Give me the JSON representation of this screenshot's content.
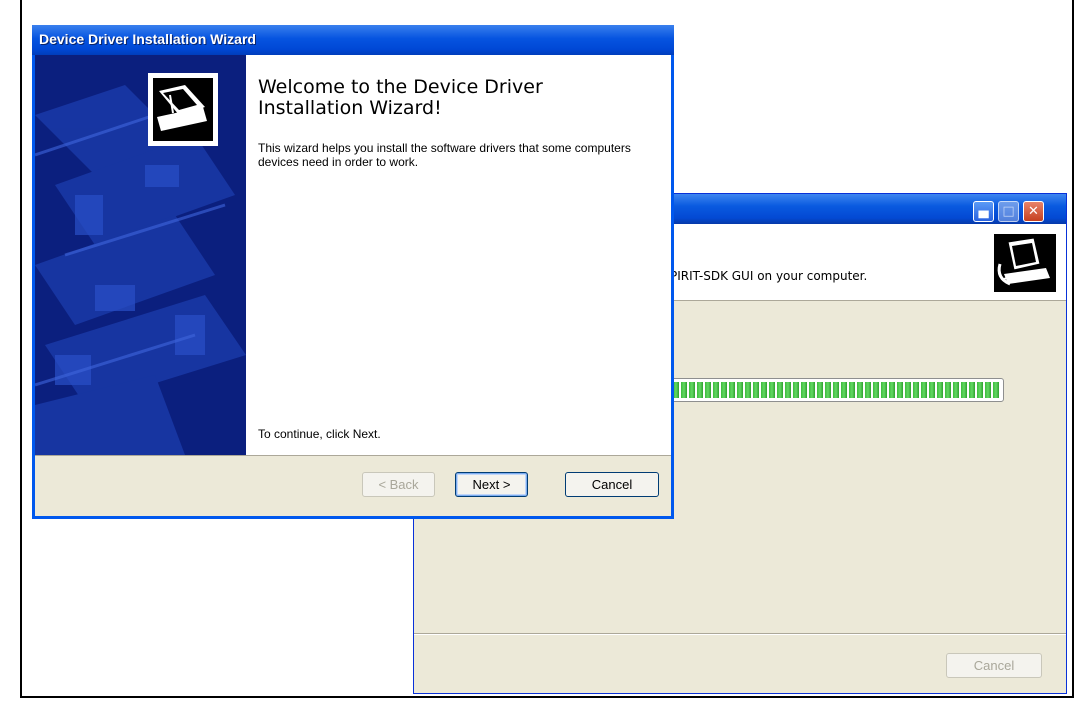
{
  "front_window": {
    "title": "Device Driver Installation Wizard",
    "welcome_heading": "Welcome to the Device Driver Installation Wizard!",
    "description": "This wizard helps you install the software drivers that some computers devices need in order to work.",
    "continue_hint": "To continue, click Next.",
    "buttons": {
      "back": "< Back",
      "next": "Next >",
      "cancel": "Cancel"
    },
    "back_enabled": false,
    "icon": "hardware-wizard-icon"
  },
  "back_window": {
    "title": "",
    "header_text": "PIRIT-SDK GUI on your computer.",
    "progress_percent": 100,
    "buttons": {
      "cancel": "Cancel"
    },
    "cancel_enabled": false,
    "controls": {
      "minimize": "minimize-icon",
      "maximize": "maximize-icon",
      "close": "close-icon"
    },
    "icon": "installer-computer-icon"
  },
  "colors": {
    "xp_title_blue": "#0058ee",
    "banner_navy": "#0b1f7e",
    "progress_green": "#3dbb3d",
    "dialog_face": "#ece9d8"
  }
}
